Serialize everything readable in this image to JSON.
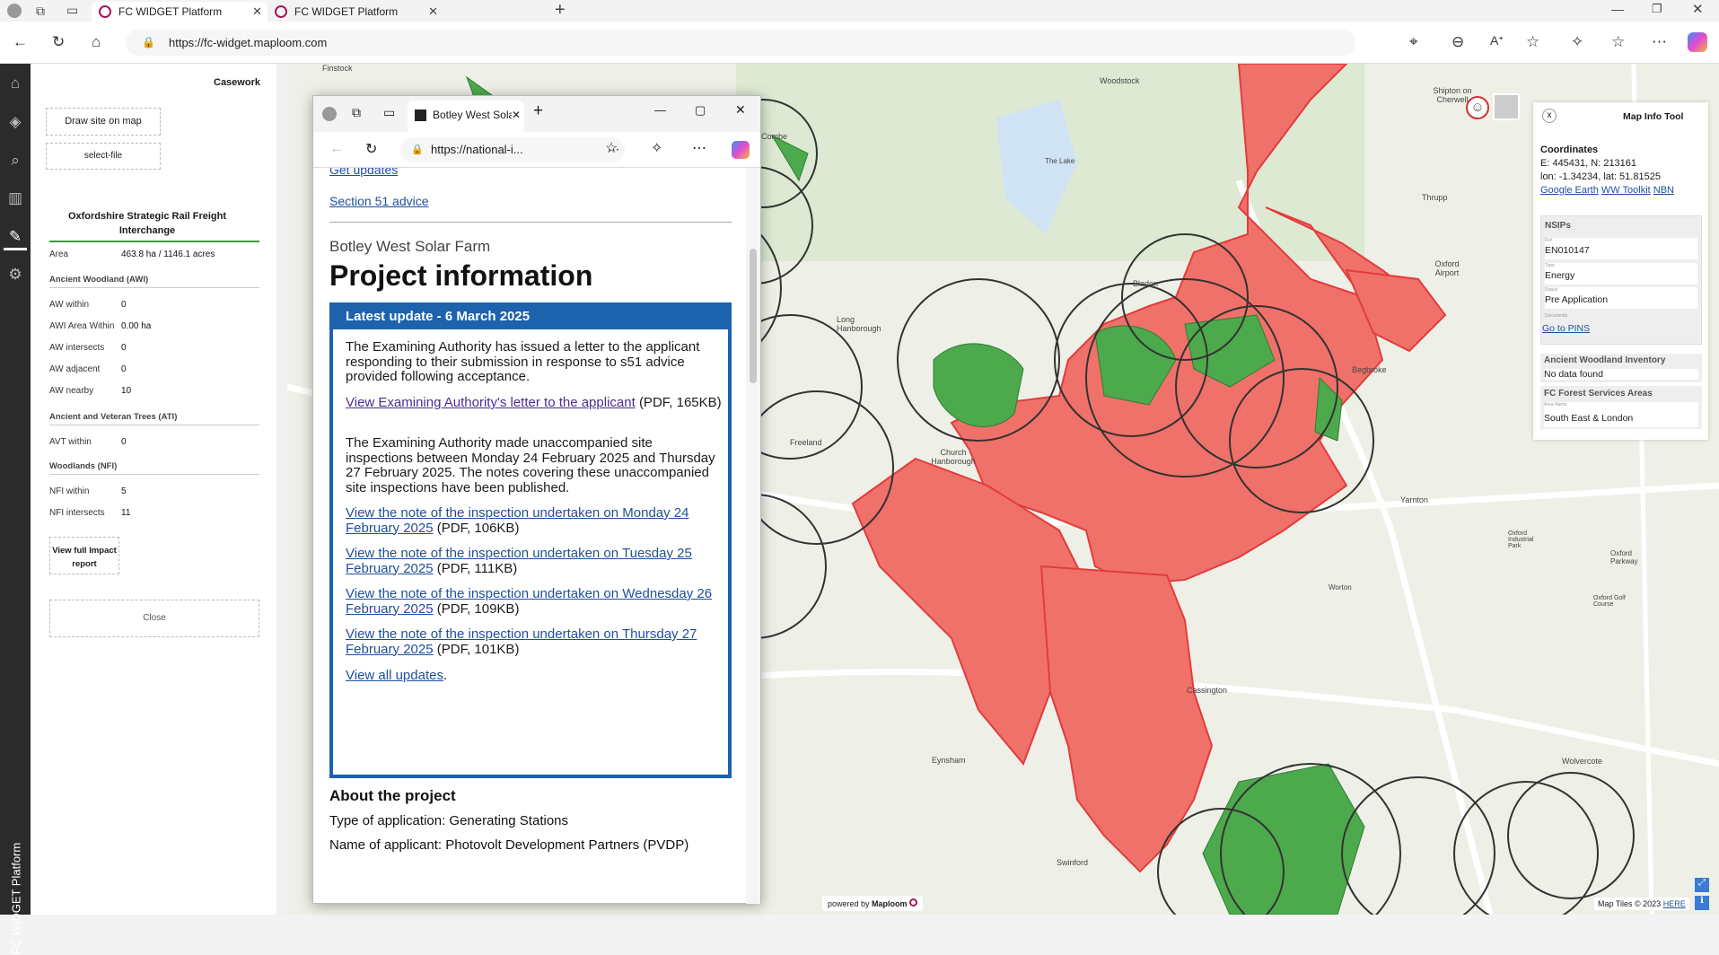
{
  "browser": {
    "tabs": [
      {
        "label": "FC WIDGET Platform"
      },
      {
        "label": "FC WIDGET Platform"
      }
    ],
    "url": "https://fc-widget.maploom.com"
  },
  "rail": {
    "title": "FC WIDGET Platform"
  },
  "panel": {
    "header": "Casework",
    "draw_btn": "Draw site on map",
    "select_file": "select-file",
    "site_title": "Oxfordshire Strategic Rail Freight Interchange",
    "area_label": "Area",
    "area_value": "463.8 ha / 1146.1 acres",
    "awi_section": "Ancient Woodland (AWI)",
    "awi": [
      {
        "k": "AW within",
        "v": "0"
      },
      {
        "k": "AWI Area Within",
        "v": "0.00 ha"
      },
      {
        "k": "AW intersects",
        "v": "0"
      },
      {
        "k": "AW adjacent",
        "v": "0"
      },
      {
        "k": "AW nearby",
        "v": "10"
      }
    ],
    "ati_section": "Ancient and Veteran Trees (ATI)",
    "ati": [
      {
        "k": "AVT within",
        "v": "0"
      }
    ],
    "nfi_section": "Woodlands (NFI)",
    "nfi": [
      {
        "k": "NFI within",
        "v": "5"
      },
      {
        "k": "NFI intersects",
        "v": "11"
      }
    ],
    "report_btn": "View full Impact report",
    "close_btn": "Close"
  },
  "popup": {
    "tab_label": "Botley West Sola",
    "url": "https://national-i...",
    "get_updates": "Get updates",
    "s51": "Section 51 advice",
    "subtitle": "Botley West Solar Farm",
    "title": "Project information",
    "update_header": "Latest update - 6 March 2025",
    "p1": "The Examining Authority has issued a letter to the applicant responding to their submission in response to s51 advice provided following acceptance.",
    "link1": "View Examining Authority's letter to the applicant",
    "link1_meta": "(PDF, 165KB)",
    "p2": "The Examining Authority made unaccompanied site inspections between Monday 24 February 2025 and Thursday 27 February 2025. The notes covering these unaccompanied site inspections have been published.",
    "link2": "View the note of the inspection undertaken on Monday 24 February 2025",
    "link2_meta": "(PDF, 106KB)",
    "link3": "View the note of the inspection undertaken on Tuesday 25 February 2025",
    "link3_meta": "(PDF, 111KB)",
    "link4": "View the note of the inspection undertaken on Wednesday 26 February 2025",
    "link4_meta": "(PDF, 109KB)",
    "link5": "View the note of the inspection undertaken on Thursday 27 February 2025",
    "link5_meta": "(PDF, 101KB)",
    "all_updates": "View all updates",
    "about": "About the project",
    "type": "Type of application: Generating Stations",
    "applicant": "Name of applicant: Photovolt Development Partners (PVDP)"
  },
  "infotool": {
    "title": "Map Info Tool",
    "close": "x",
    "coords_h": "Coordinates",
    "en": "E: 445431, N: 213161",
    "ll": "lon: -1.34234, lat: 51.81525",
    "links": [
      "Google Earth",
      "WW Toolkit",
      "NBN"
    ],
    "nsips_h": "NSIPs",
    "ref_lbl": "Ref",
    "ref": "EN010147",
    "type_lbl": "Type",
    "type": "Energy",
    "status_lbl": "Status",
    "status": "Pre Application",
    "docs_lbl": "Documents",
    "docs": "Go to PINS",
    "awi_h": "Ancient Woodland Inventory",
    "awi_v": "No data found",
    "fc_h": "FC Forest Services Areas",
    "area_lbl": "Area Name",
    "area_v": "South East & London"
  },
  "map": {
    "places": [
      {
        "t": "Woodstock"
      },
      {
        "t": "Shipton on Cherwell"
      },
      {
        "t": "Combe"
      },
      {
        "t": "Bladon"
      },
      {
        "t": "Long Hanborough"
      },
      {
        "t": "Freeland"
      },
      {
        "t": "Church Hanborough"
      },
      {
        "t": "Begbroke"
      },
      {
        "t": "Yarnton"
      },
      {
        "t": "Oxford Airport"
      },
      {
        "t": "Thrupp"
      },
      {
        "t": "Cassington"
      },
      {
        "t": "Eynsham"
      },
      {
        "t": "Swinford"
      },
      {
        "t": "Wolvercote"
      },
      {
        "t": "Oxford Parkway"
      },
      {
        "t": "Worton"
      },
      {
        "t": "The Lake"
      },
      {
        "t": "Oxford Golf Course"
      },
      {
        "t": "Oxford Industrial Park"
      },
      {
        "t": "Finstock"
      }
    ],
    "powered": "powered by",
    "brand": "Maploom",
    "attrib": "Map Tiles © 2023",
    "here": "HERE"
  }
}
